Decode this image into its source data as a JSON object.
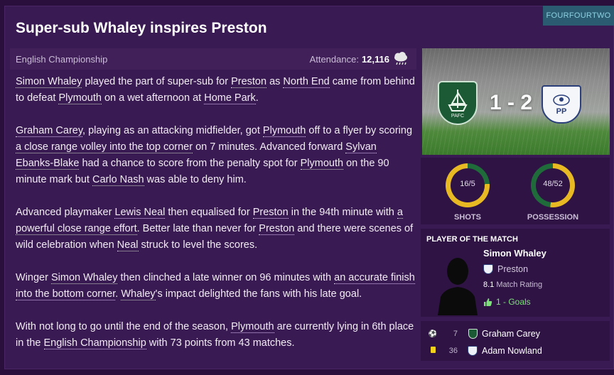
{
  "source": "FOURFOURTWO",
  "headline": "Super-sub Whaley inspires Preston",
  "meta": {
    "competition": "English Championship",
    "attendance_label": "Attendance:",
    "attendance_value": "12,116",
    "weather_icon": "rain-cloud-icon"
  },
  "article": [
    [
      {
        "t": "Simon Whaley",
        "link": true
      },
      {
        "t": " played the part of super-sub for "
      },
      {
        "t": "Preston",
        "link": true
      },
      {
        "t": " as "
      },
      {
        "t": "North End",
        "link": true
      },
      {
        "t": " came from behind to defeat "
      },
      {
        "t": "Plymouth",
        "link": true
      },
      {
        "t": " on a wet afternoon at "
      },
      {
        "t": "Home Park",
        "link": true
      },
      {
        "t": "."
      }
    ],
    [
      {
        "t": "Graham Carey",
        "link": true
      },
      {
        "t": ", playing as an attacking midfielder, got "
      },
      {
        "t": "Plymouth",
        "link": true
      },
      {
        "t": " off to a flyer by scoring "
      },
      {
        "t": "a close range volley into the top corner",
        "link": true
      },
      {
        "t": " on 7 minutes. Advanced forward "
      },
      {
        "t": "Sylvan Ebanks-Blake",
        "link": true
      },
      {
        "t": " had a chance to score from the penalty spot for "
      },
      {
        "t": "Plymouth",
        "link": true
      },
      {
        "t": " on the 90 minute mark but "
      },
      {
        "t": "Carlo Nash",
        "link": true
      },
      {
        "t": " was able to deny him."
      }
    ],
    [
      {
        "t": "Advanced playmaker "
      },
      {
        "t": "Lewis Neal",
        "link": true
      },
      {
        "t": " then equalised for "
      },
      {
        "t": "Preston",
        "link": true
      },
      {
        "t": " in the 94th minute with "
      },
      {
        "t": "a powerful close range effort",
        "link": true
      },
      {
        "t": ". Better late than never for "
      },
      {
        "t": "Preston",
        "link": true
      },
      {
        "t": " and there were scenes of wild celebration when "
      },
      {
        "t": "Neal",
        "link": true
      },
      {
        "t": " struck to level the scores."
      }
    ],
    [
      {
        "t": "Winger "
      },
      {
        "t": "Simon Whaley",
        "link": true
      },
      {
        "t": " then clinched a late winner on 96 minutes with "
      },
      {
        "t": "an accurate finish into the bottom corner",
        "link": true
      },
      {
        "t": ". "
      },
      {
        "t": "Whaley",
        "link": true
      },
      {
        "t": "'s impact delighted the fans with his late goal."
      }
    ],
    [
      {
        "t": "With not long to go until the end of the season, "
      },
      {
        "t": "Plymouth",
        "link": true
      },
      {
        "t": " are currently lying in 6th place in the "
      },
      {
        "t": "English Championship",
        "link": true
      },
      {
        "t": " with 73 points from 43 matches."
      }
    ]
  ],
  "match": {
    "score": "1 - 2",
    "home_crest_icon": "plymouth-crest-icon",
    "away_crest_icon": "preston-crest-icon",
    "home_crest_text": "PAFC",
    "away_crest_text": "PP"
  },
  "stats": {
    "shots": {
      "label": "SHOTS",
      "value": "16/5",
      "home_fraction": 0.762,
      "home_color": "#e8b923",
      "away_color": "#1f6b3a"
    },
    "possession": {
      "label": "POSSESSION",
      "value": "48/52",
      "home_fraction": 0.48,
      "home_color": "#1f6b3a",
      "away_color": "#e8b923"
    }
  },
  "potm": {
    "title": "PLAYER OF THE MATCH",
    "name": "Simon Whaley",
    "club": "Preston",
    "rating_value": "8.1",
    "rating_label": "Match Rating",
    "goals_text": "1 - Goals"
  },
  "events": [
    {
      "icon": "football-icon",
      "minute": "7",
      "club": "home",
      "player": "Graham Carey"
    },
    {
      "icon": "yellow-card-icon",
      "minute": "36",
      "club": "away",
      "player": "Adam Nowland"
    }
  ]
}
